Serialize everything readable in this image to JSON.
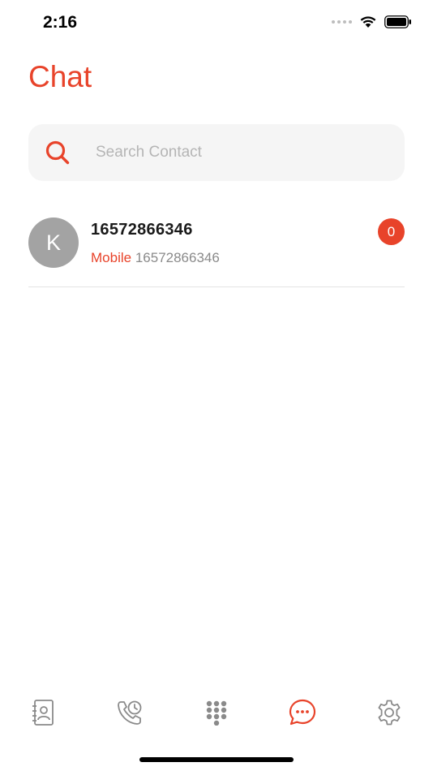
{
  "status_bar": {
    "time": "2:16"
  },
  "header": {
    "title": "Chat"
  },
  "search": {
    "placeholder": "Search Contact"
  },
  "contacts": [
    {
      "avatar_initial": "K",
      "name": "16572866346",
      "type_label": "Mobile",
      "number": "16572866346",
      "unread_count": "0"
    }
  ],
  "tab_bar": {
    "tabs": [
      {
        "icon": "contacts-book-icon",
        "active": false
      },
      {
        "icon": "call-history-icon",
        "active": false
      },
      {
        "icon": "dialpad-icon",
        "active": false
      },
      {
        "icon": "chat-bubble-icon",
        "active": true
      },
      {
        "icon": "settings-gear-icon",
        "active": false
      }
    ]
  },
  "colors": {
    "accent": "#e8432a",
    "inactive_icon": "#8a8a8a",
    "search_background": "#f5f5f5",
    "avatar_background": "#a3a3a3"
  }
}
